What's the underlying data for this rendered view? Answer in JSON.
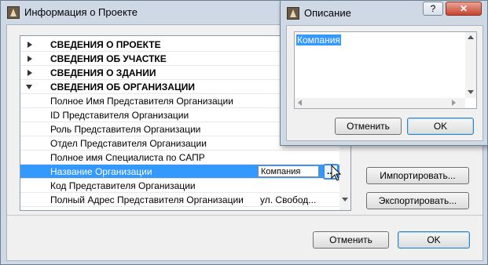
{
  "main_window": {
    "title": "Информация о Проекте",
    "help_glyph": "?",
    "close_glyph": "✕",
    "icon": "archicad-app-icon"
  },
  "property_list": {
    "groups": [
      {
        "label": "СВЕДЕНИЯ О ПРОЕКТЕ",
        "expanded": false
      },
      {
        "label": "СВЕДЕНИЯ ОБ УЧАСТКЕ",
        "expanded": false
      },
      {
        "label": "СВЕДЕНИЯ О ЗДАНИИ",
        "expanded": false
      },
      {
        "label": "СВЕДЕНИЯ ОБ ОРГАНИЗАЦИИ",
        "expanded": true
      }
    ],
    "items": [
      {
        "label": "Полное Имя Представителя Организации",
        "value": ""
      },
      {
        "label": "ID Представителя Организации",
        "value": ""
      },
      {
        "label": "Роль Представителя Организации",
        "value": ""
      },
      {
        "label": "Отдел Представителя Организации",
        "value": ""
      },
      {
        "label": "Полное имя Специалиста по САПР",
        "value": ""
      },
      {
        "label": "Название Организации",
        "value": "Компания",
        "selected": true
      },
      {
        "label": "Код Представителя Организации",
        "value": ""
      },
      {
        "label": "Полный Адрес Представителя Организации",
        "value": "ул. Свобод..."
      }
    ],
    "ellipsis_label": "..."
  },
  "side_buttons": {
    "import": "Импортировать...",
    "export": "Экспортировать..."
  },
  "footer": {
    "cancel": "Отменить",
    "ok": "OK"
  },
  "popup": {
    "title": "Описание",
    "help_glyph": "?",
    "close_glyph": "✕",
    "text": "Компания",
    "cancel": "Отменить",
    "ok": "OK"
  },
  "colors": {
    "selection": "#3399ff",
    "titlebar": "#cfd9e6",
    "close_button": "#c7452f"
  }
}
